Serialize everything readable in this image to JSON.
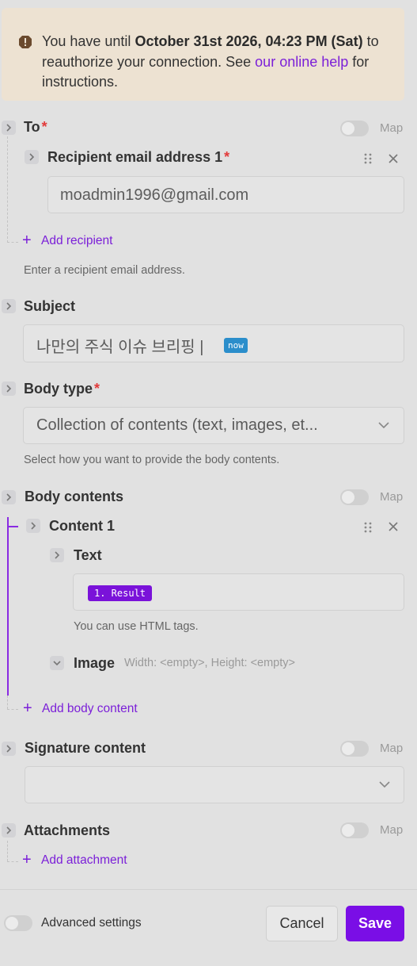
{
  "warning": {
    "prefix": "You have until ",
    "deadline": "October 31st 2026, 04:23 PM (Sat)",
    "middle": " to reauthorize your connection. See ",
    "link": "our online help",
    "suffix": " for instructions."
  },
  "to": {
    "label": "To",
    "map_label": "Map",
    "recipient_label": "Recipient email address 1",
    "recipient_value": "moadmin1996@gmail.com",
    "add_recipient": "Add recipient",
    "hint": "Enter a recipient email address."
  },
  "subject": {
    "label": "Subject",
    "value": "나만의 주식 이슈 브리핑 |",
    "tag": "now"
  },
  "body_type": {
    "label": "Body type",
    "value": "Collection of contents (text, images, et...",
    "hint": "Select how you want to provide the body contents."
  },
  "body_contents": {
    "label": "Body contents",
    "map_label": "Map",
    "content_label": "Content 1",
    "text_label": "Text",
    "text_tag": "1. Result",
    "text_hint": "You can use HTML tags.",
    "image_label": "Image",
    "image_meta": "Width: <empty>, Height: <empty>",
    "add_body": "Add body content"
  },
  "signature": {
    "label": "Signature content",
    "map_label": "Map"
  },
  "attachments": {
    "label": "Attachments",
    "map_label": "Map",
    "add_attachment": "Add attachment"
  },
  "footer": {
    "advanced": "Advanced settings",
    "cancel": "Cancel",
    "save": "Save"
  },
  "colors": {
    "accent": "#7a0ee6",
    "required": "#e23b3b",
    "now_tag": "#2b8ecb"
  }
}
